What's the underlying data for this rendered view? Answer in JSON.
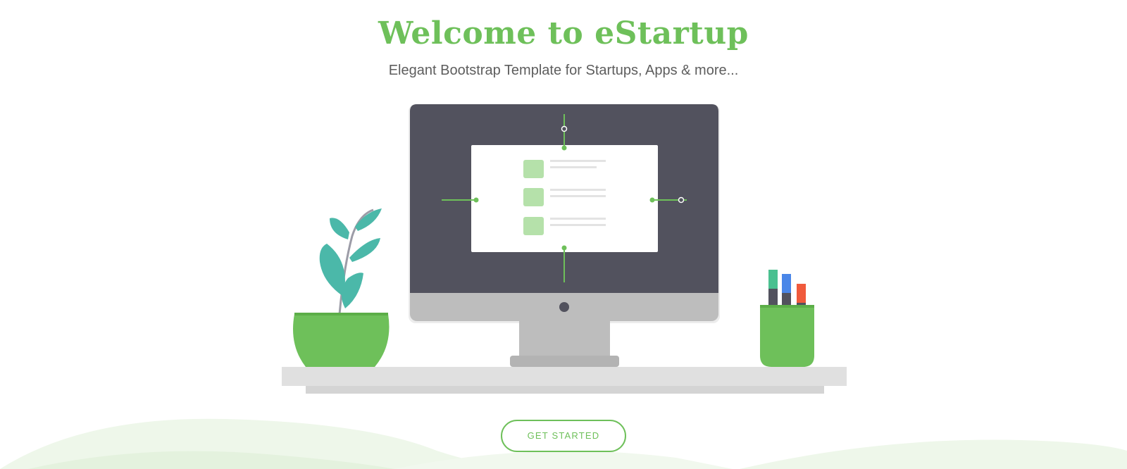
{
  "hero": {
    "title": "Welcome to eStartup",
    "subtitle": "Elegant Bootstrap Template for Startups, Apps & more...",
    "cta_label": "GET STARTED"
  },
  "colors": {
    "brand_green": "#6ec05a",
    "monitor_dark": "#52525e",
    "leaf_teal": "#4bb8a9",
    "desk_gray": "#e0e0e0"
  }
}
